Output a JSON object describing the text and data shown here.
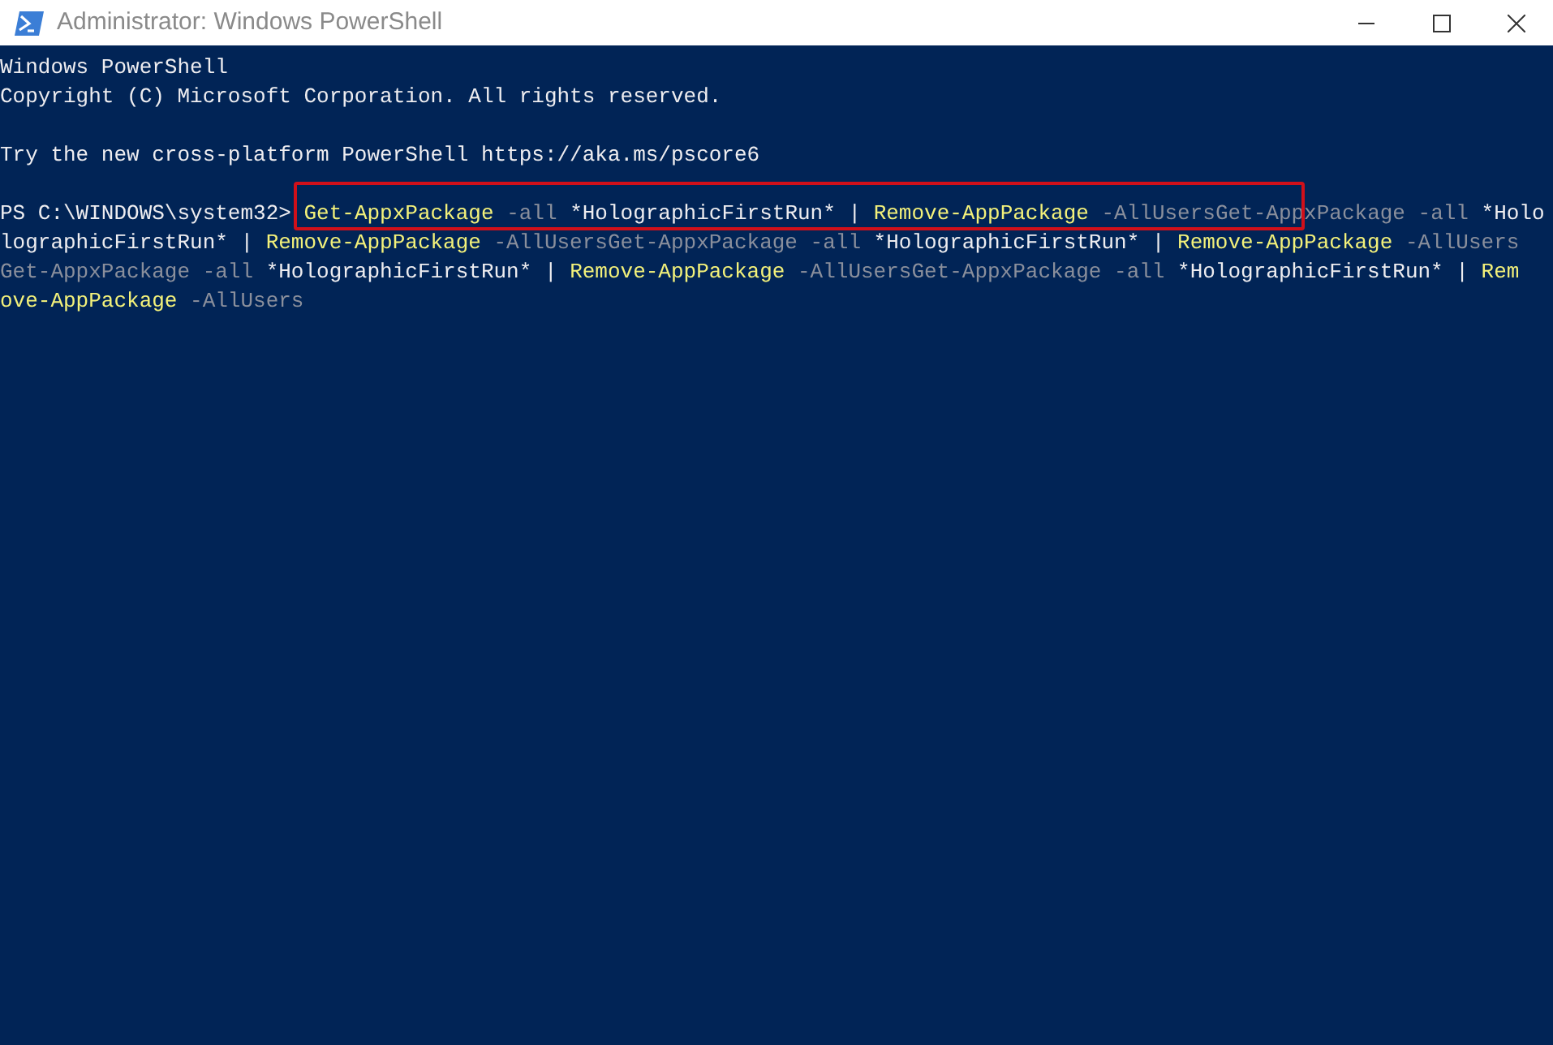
{
  "window": {
    "title": "Administrator: Windows PowerShell"
  },
  "console": {
    "blocks": [
      [
        [
          {
            "kind": "plain",
            "text": "Windows PowerShell"
          }
        ],
        [
          {
            "kind": "plain",
            "text": "Copyright (C) Microsoft Corporation. All rights reserved."
          }
        ]
      ],
      [
        [
          {
            "kind": "plain",
            "text": "Try the new cross-platform PowerShell https://aka.ms/pscore6"
          }
        ]
      ],
      [
        [
          {
            "kind": "plain",
            "text": "PS C:\\WINDOWS\\system32> "
          },
          {
            "kind": "command",
            "text": "Get-AppxPackage"
          },
          {
            "kind": "param",
            "text": " -all "
          },
          {
            "kind": "plain",
            "text": "*HolographicFirstRun* | "
          },
          {
            "kind": "command",
            "text": "Remove-AppPackage"
          },
          {
            "kind": "param",
            "text": " -AllUsersGet-AppxPackage -all "
          },
          {
            "kind": "plain",
            "text": "*Holo"
          }
        ],
        [
          {
            "kind": "plain",
            "text": "lographicFirstRun* | "
          },
          {
            "kind": "command",
            "text": "Remove-AppPackage"
          },
          {
            "kind": "param",
            "text": " -AllUsersGet-AppxPackage -all "
          },
          {
            "kind": "plain",
            "text": "*HolographicFirstRun* | "
          },
          {
            "kind": "command",
            "text": "Remove-AppPackage"
          },
          {
            "kind": "param",
            "text": " -AllUsers"
          }
        ],
        [
          {
            "kind": "param",
            "text": "Get-AppxPackage -all "
          },
          {
            "kind": "plain",
            "text": "*HolographicFirstRun* | "
          },
          {
            "kind": "command",
            "text": "Remove-AppPackage"
          },
          {
            "kind": "param",
            "text": " -AllUsersGet-AppxPackage -all "
          },
          {
            "kind": "plain",
            "text": "*HolographicFirstRun* | "
          },
          {
            "kind": "command",
            "text": "Rem"
          }
        ],
        [
          {
            "kind": "command",
            "text": "ove-AppPackage"
          },
          {
            "kind": "param",
            "text": " -AllUsers"
          }
        ]
      ]
    ]
  }
}
